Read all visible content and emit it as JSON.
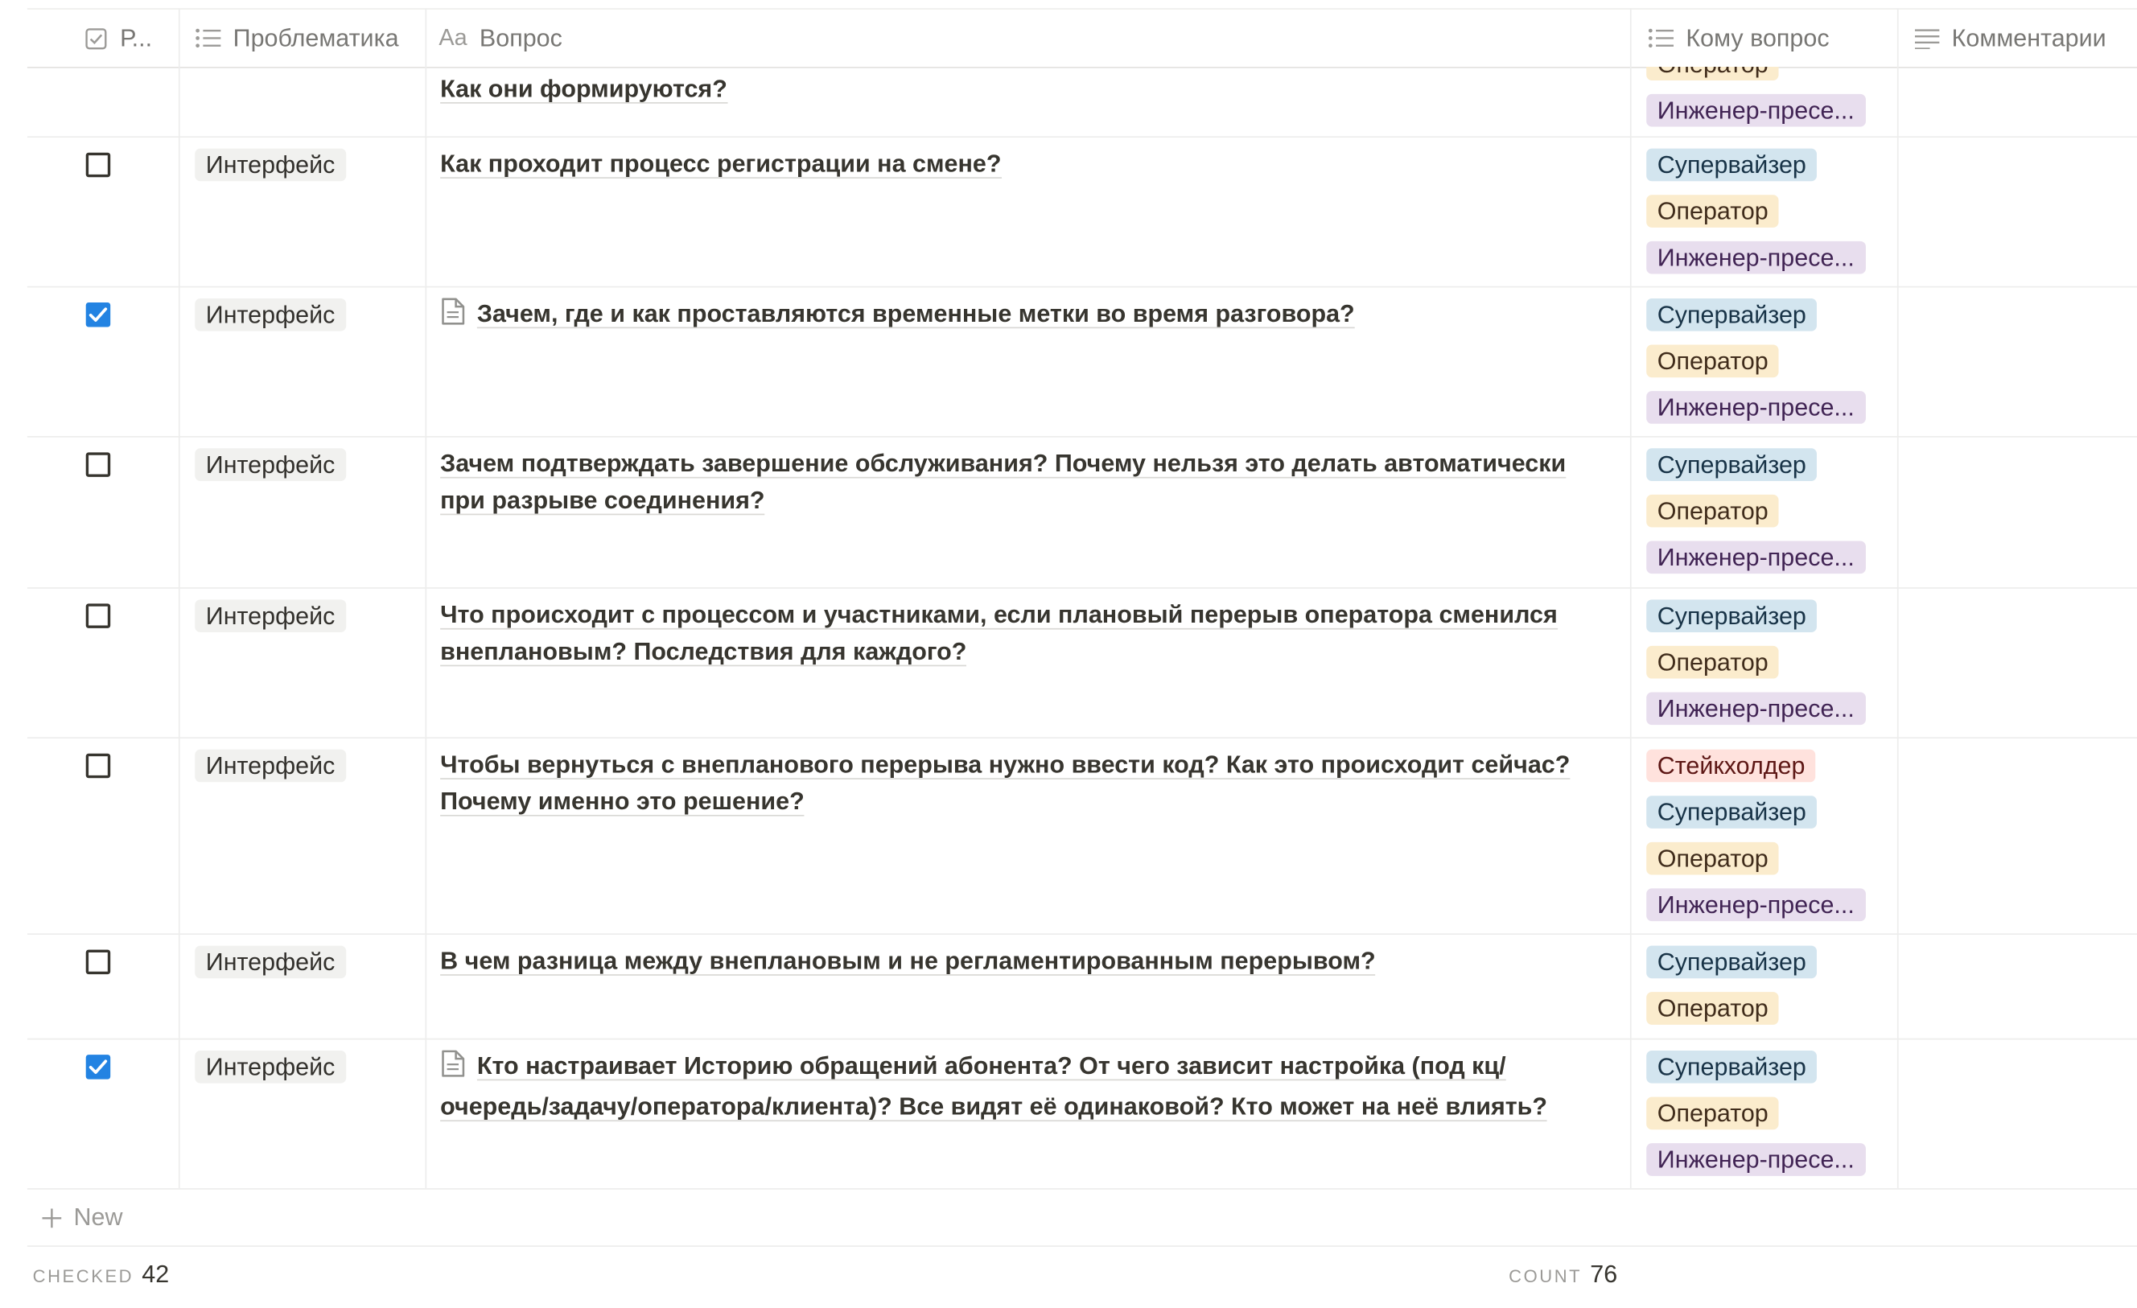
{
  "columns": [
    {
      "label": "Р...",
      "icon": "checkbox-property-icon"
    },
    {
      "label": "Проблематика",
      "icon": "list-property-icon"
    },
    {
      "label": "Вопрос",
      "icon": "text-property-icon",
      "icon_text": "Aa"
    },
    {
      "label": "Кому вопрос",
      "icon": "list-property-icon"
    },
    {
      "label": "Комментарии",
      "icon": "lines-property-icon"
    }
  ],
  "tag_colors": {
    "Оператор": {
      "bg": "#fbeccd",
      "fg": "#402c1b"
    },
    "Инженер-пресе...": {
      "bg": "#e8deee",
      "fg": "#412454"
    },
    "Супервайзер": {
      "bg": "#d3e5ef",
      "fg": "#183347"
    },
    "Стейкхолдер": {
      "bg": "#ffe2dd",
      "fg": "#5d1715"
    }
  },
  "rows": [
    {
      "checked": null,
      "category": "",
      "question": "Как они формируются?",
      "has_page_icon": false,
      "tags": [
        "Оператор",
        "Инженер-пресе..."
      ],
      "partial": true
    },
    {
      "checked": false,
      "category": "Интерфейс",
      "question": "Как проходит процесс регистрации на смене?",
      "has_page_icon": false,
      "tags": [
        "Супервайзер",
        "Оператор",
        "Инженер-пресе..."
      ]
    },
    {
      "checked": true,
      "category": "Интерфейс",
      "question": "Зачем, где и как проставляются временные метки во время разговора?",
      "has_page_icon": true,
      "tags": [
        "Супервайзер",
        "Оператор",
        "Инженер-пресе..."
      ]
    },
    {
      "checked": false,
      "category": "Интерфейс",
      "question": "Зачем подтверждать завершение обслуживания? Почему нельзя это делать автоматически при разрыве соединения?",
      "has_page_icon": false,
      "tags": [
        "Супервайзер",
        "Оператор",
        "Инженер-пресе..."
      ]
    },
    {
      "checked": false,
      "category": "Интерфейс",
      "question": "Что происходит с процессом и участниками, если плановый перерыв оператора сменился внеплановым? Последствия для каждого?",
      "has_page_icon": false,
      "tags": [
        "Супервайзер",
        "Оператор",
        "Инженер-пресе..."
      ]
    },
    {
      "checked": false,
      "category": "Интерфейс",
      "question": "Чтобы вернуться с внепланового перерыва нужно ввести код? Как это происходит сейчас? Почему именно это решение?",
      "has_page_icon": false,
      "tags": [
        "Стейкхолдер",
        "Супервайзер",
        "Оператор",
        "Инженер-пресе..."
      ]
    },
    {
      "checked": false,
      "category": "Интерфейс",
      "question": "В чем разница между внеплановым и не регламентированным перерывом?",
      "has_page_icon": false,
      "tags": [
        "Супервайзер",
        "Оператор"
      ]
    },
    {
      "checked": true,
      "category": "Интерфейс",
      "question": "Кто настраивает Историю обращений абонента? От чего зависит настройка (под кц/очередь/задачу/оператора/клиента)? Все видят её одинаковой? Кто может на неё влиять?",
      "has_page_icon": true,
      "tags": [
        "Супервайзер",
        "Оператор",
        "Инженер-пресе..."
      ]
    }
  ],
  "new_row_label": "New",
  "footer": {
    "checked_label": "CHECKED",
    "checked_value": "42",
    "count_label": "COUNT",
    "count_value": "76"
  }
}
